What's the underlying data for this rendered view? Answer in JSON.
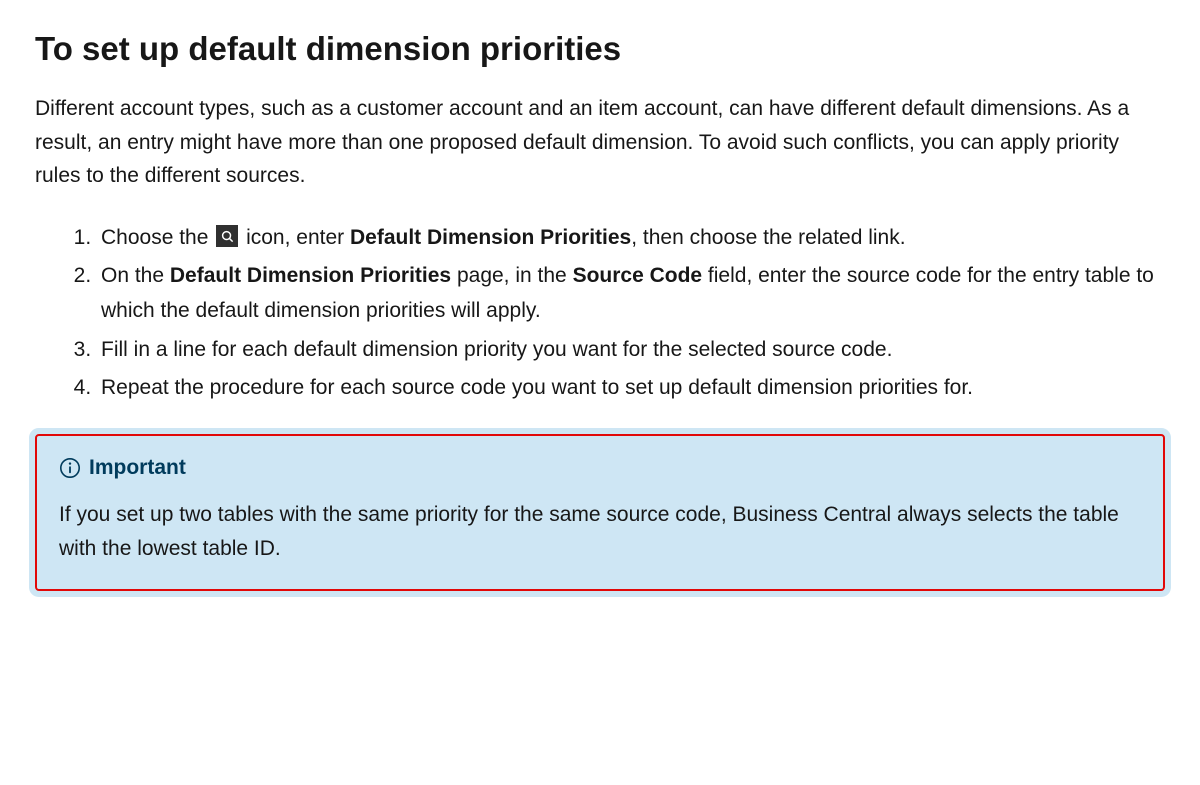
{
  "heading": "To set up default dimension priorities",
  "intro": "Different account types, such as a customer account and an item account, can have different default dimensions. As a result, an entry might have more than one proposed default dimension. To avoid such conflicts, you can apply priority rules to the different sources.",
  "steps": {
    "s1_pre": "Choose the ",
    "s1_post_icon": " icon, enter ",
    "s1_bold": "Default Dimension Priorities",
    "s1_tail": ", then choose the related link.",
    "s2_pre": "On the ",
    "s2_bold1": "Default Dimension Priorities",
    "s2_mid": " page, in the ",
    "s2_bold2": "Source Code",
    "s2_tail": " field, enter the source code for the entry table to which the default dimension priorities will apply.",
    "s3": "Fill in a line for each default dimension priority you want for the selected source code.",
    "s4": "Repeat the procedure for each source code you want to set up default dimension priorities for."
  },
  "alert": {
    "title": "Important",
    "body": "If you set up two tables with the same priority for the same source code, Business Central always selects the table with the lowest table ID."
  }
}
